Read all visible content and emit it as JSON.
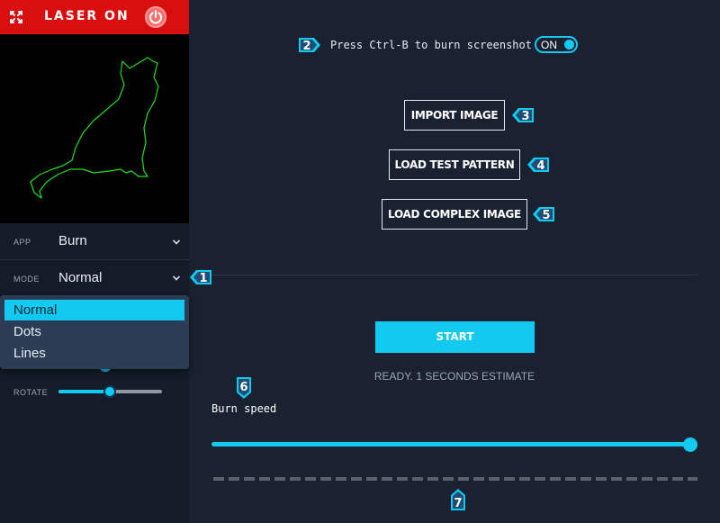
{
  "header": {
    "title": "LASER ON",
    "expand_icon": "expand-arrows-icon",
    "power_icon": "power-icon"
  },
  "preview": {
    "image": "cat-outline",
    "stroke_color": "#1fe01f"
  },
  "settings": {
    "app": {
      "label": "APP",
      "value": "Burn"
    },
    "mode": {
      "label": "MODE",
      "value": "Normal",
      "options": [
        "Normal",
        "Dots",
        "Lines"
      ],
      "selected_index": 0
    },
    "rotate": {
      "label": "ROTATE",
      "value_fraction": 0.5
    }
  },
  "main": {
    "shortcut_text": "Press Ctrl-B to burn screenshot",
    "toggle": {
      "label": "ON",
      "state": true
    },
    "buttons": {
      "import": "IMPORT IMAGE",
      "test_pattern": "LOAD TEST PATTERN",
      "complex": "LOAD COMPLEX IMAGE",
      "start": "START"
    },
    "status": "READY. 1 SECONDS ESTIMATE",
    "burn_speed": {
      "label": "Burn speed",
      "value_fraction": 1.0
    }
  },
  "badges": [
    "1",
    "2",
    "3",
    "4",
    "5",
    "6",
    "7"
  ],
  "colors": {
    "accent": "#12c9ef",
    "header_red": "#d90f0f",
    "background": "#1a2130"
  }
}
